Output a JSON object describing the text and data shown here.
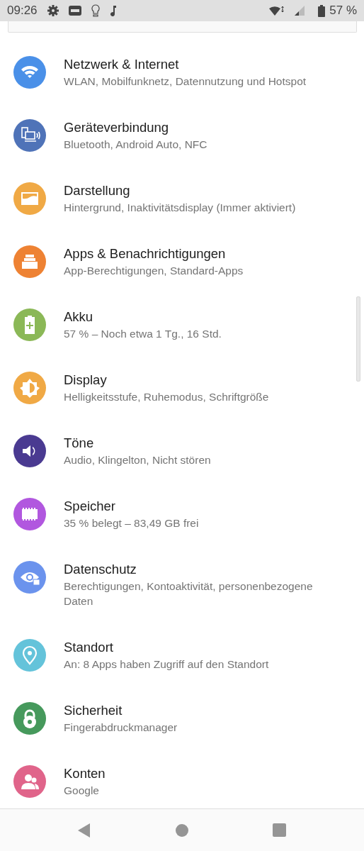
{
  "status_bar": {
    "time": "09:26",
    "battery": "57 %"
  },
  "settings": [
    {
      "kind": "wifi",
      "color": "#4a90e8",
      "title": "Netzwerk & Internet",
      "subtitle": "WLAN, Mobilfunknetz, Datennutzung und Hotspot"
    },
    {
      "kind": "devices",
      "color": "#4f73b8",
      "title": "Geräteverbindung",
      "subtitle": "Bluetooth, Android Auto, NFC"
    },
    {
      "kind": "wallpaper",
      "color": "#f0a945",
      "title": "Darstellung",
      "subtitle": "Hintergrund, Inaktivitätsdisplay (Immer aktiviert)"
    },
    {
      "kind": "apps",
      "color": "#ee8233",
      "title": "Apps & Benachrichtigungen",
      "subtitle": "App-Berechtigungen, Standard-Apps"
    },
    {
      "kind": "battery",
      "color": "#8bb857",
      "title": "Akku",
      "subtitle": "57 % – Noch etwa 1 Tg., 16 Std."
    },
    {
      "kind": "brightness",
      "color": "#f0a945",
      "title": "Display",
      "subtitle": "Helligkeitsstufe, Ruhemodus, Schriftgröße"
    },
    {
      "kind": "sound",
      "color": "#4a3a91",
      "title": "Töne",
      "subtitle": "Audio, Klingelton, Nicht stören"
    },
    {
      "kind": "storage",
      "color": "#b157df",
      "title": "Speicher",
      "subtitle": "35 % belegt – 83,49 GB frei"
    },
    {
      "kind": "privacy",
      "color": "#6b93ed",
      "title": "Datenschutz",
      "subtitle": "Berechtigungen, Kontoaktivität, personenbezogene Daten"
    },
    {
      "kind": "location",
      "color": "#64c3da",
      "title": "Standort",
      "subtitle": "An: 8 Apps haben Zugriff auf den Standort"
    },
    {
      "kind": "lock",
      "color": "#46995c",
      "title": "Sicherheit",
      "subtitle": "Fingerabdruckmanager"
    },
    {
      "kind": "accounts",
      "color": "#e0648a",
      "title": "Konten",
      "subtitle": "Google"
    }
  ]
}
